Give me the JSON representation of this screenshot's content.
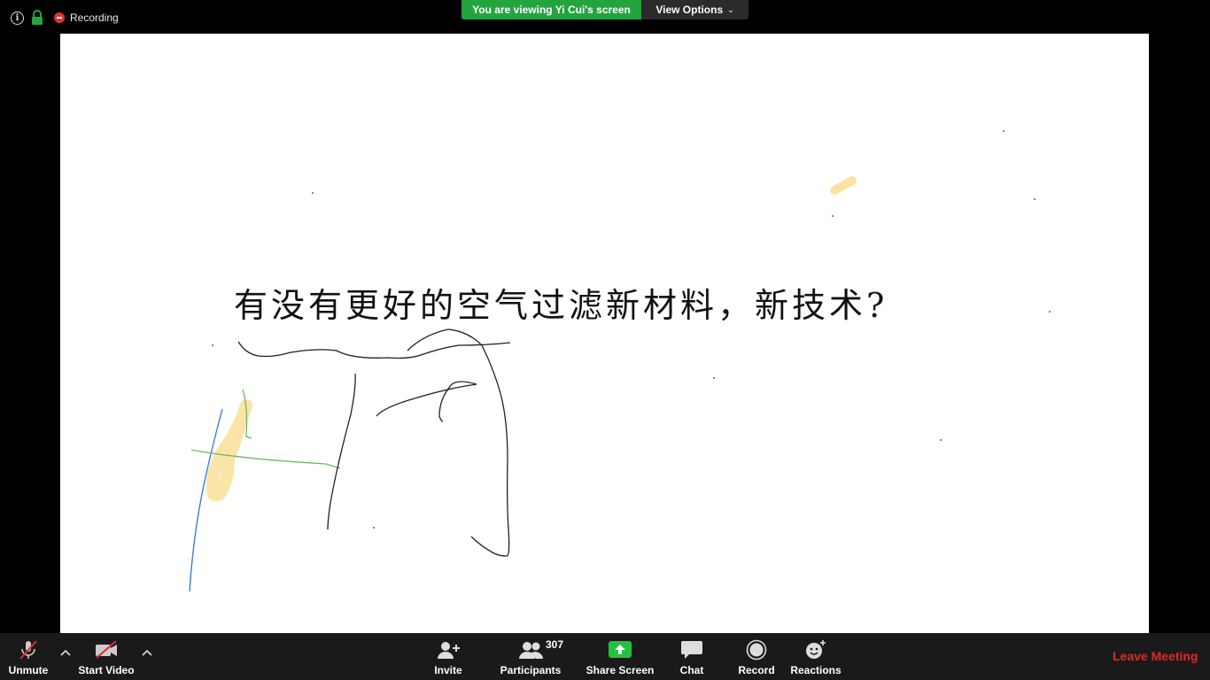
{
  "status": {
    "info_icon": "info-icon",
    "lock_icon": "lock-icon",
    "recording_label": "Recording",
    "recording_color": "#e0332f"
  },
  "banner": {
    "viewing_text": "You are viewing Yi Cui's screen",
    "view_options_label": "View Options",
    "green": "#23a43e"
  },
  "shared_screen": {
    "title": "有没有更好的空气过滤新材料，新技术?"
  },
  "toolbar": {
    "unmute_label": "Unmute",
    "start_video_label": "Start Video",
    "invite_label": "Invite",
    "participants_label": "Participants",
    "participants_count": "307",
    "share_screen_label": "Share Screen",
    "chat_label": "Chat",
    "record_label": "Record",
    "reactions_label": "Reactions",
    "leave_label": "Leave Meeting",
    "leave_color": "#e02828"
  }
}
